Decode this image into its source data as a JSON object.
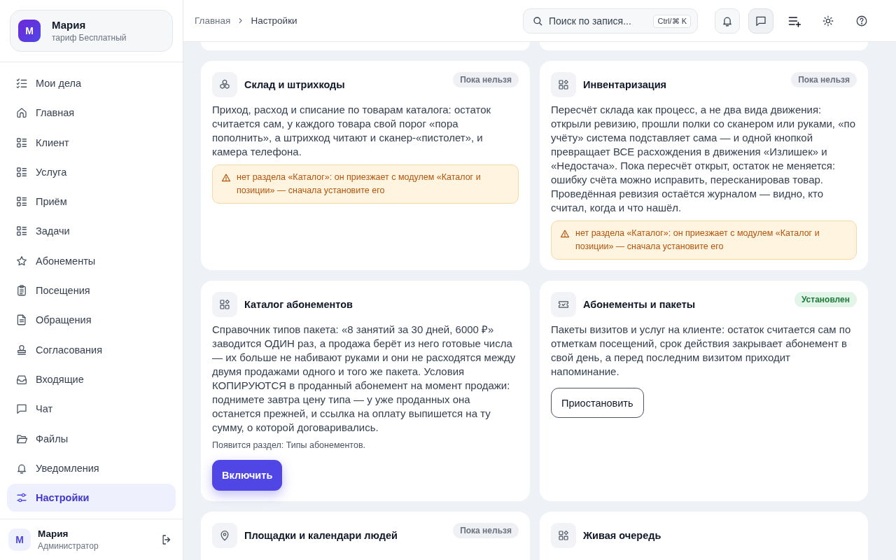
{
  "sidebar": {
    "profile": {
      "initial": "М",
      "name": "Мария",
      "plan": "тариф Бесплатный"
    },
    "nav": [
      {
        "label": "Мои дела",
        "selected": false
      },
      {
        "label": "Главная",
        "selected": false
      },
      {
        "label": "Клиент",
        "selected": false
      },
      {
        "label": "Услуга",
        "selected": false
      },
      {
        "label": "Приём",
        "selected": false
      },
      {
        "label": "Задачи",
        "selected": false
      },
      {
        "label": "Абонементы",
        "selected": false
      },
      {
        "label": "Посещения",
        "selected": false
      },
      {
        "label": "Обращения",
        "selected": false
      },
      {
        "label": "Согласования",
        "selected": false
      },
      {
        "label": "Входящие",
        "selected": false
      },
      {
        "label": "Чат",
        "selected": false
      },
      {
        "label": "Файлы",
        "selected": false
      },
      {
        "label": "Уведомления",
        "selected": false
      },
      {
        "label": "Настройки",
        "selected": true
      }
    ],
    "user": {
      "initial": "М",
      "name": "Мария",
      "role": "Администратор"
    }
  },
  "topbar": {
    "breadcrumbs": [
      "Главная",
      "Настройки"
    ],
    "search": {
      "placeholder": "Поиск по запися...",
      "shortcut": "Ctrl/⌘ K"
    }
  },
  "modules": [
    {
      "title": "Склад и штрихкоды",
      "badge": {
        "kind": "unavailable",
        "label": "Пока нельзя"
      },
      "description": "Приход, расход и списание по товарам каталога: остаток считается сам, у каждого товара свой порог «пора пополнить», а штрихкод читают и сканер-«пистолет», и камера телефона.",
      "alert": "нет раздела «Каталог»: он приезжает с модулем «Каталог и позиции» — сначала установите его"
    },
    {
      "title": "Инвентаризация",
      "badge": {
        "kind": "unavailable",
        "label": "Пока нельзя"
      },
      "description": "Пересчёт склада как процесс, а не два вида движения: открыли ревизию, прошли полки со сканером или руками, «по учёту» система подставляет сама — и одной кнопкой превращает ВСЕ расхождения в движения «Излишек» и «Недостача». Пока пересчёт открыт, остаток не меняется: ошибку счёта можно исправить, пересканировав товар. Проведённая ревизия остаётся журналом — видно, кто считал, когда и что нашёл.",
      "alert": "нет раздела «Каталог»: он приезжает с модулем «Каталог и позиции» — сначала установите его"
    },
    {
      "title": "Каталог абонементов",
      "description": "Справочник типов пакета: «8 занятий за 30 дней, 6000 ₽» заводится ОДИН раз, а продажа берёт из него готовые числа — их больше не набивают руками и они не расходятся между двумя продажами одного и того же пакета. Условия КОПИРУЮТСЯ в проданный абонемент на момент продажи: поднимете завтра цену типа — у уже проданных она останется прежней, и ссылка на оплату выпишется на ту сумму, о которой договаривались.",
      "note": "Появится раздел: Типы абонементов.",
      "action": {
        "kind": "primary",
        "label": "Включить"
      }
    },
    {
      "title": "Абонементы и пакеты",
      "badge": {
        "kind": "installed",
        "label": "Установлен"
      },
      "description": "Пакеты визитов и услуг на клиенте: остаток считается сам по отметкам посещений, срок действия закрывает абонемент в свой день, а перед последним визитом приходит напоминание.",
      "action": {
        "kind": "secondary",
        "label": "Приостановить"
      }
    },
    {
      "title": "Площадки и календари людей",
      "badge": {
        "kind": "unavailable",
        "label": "Пока нельзя"
      }
    },
    {
      "title": "Живая очередь"
    }
  ]
}
